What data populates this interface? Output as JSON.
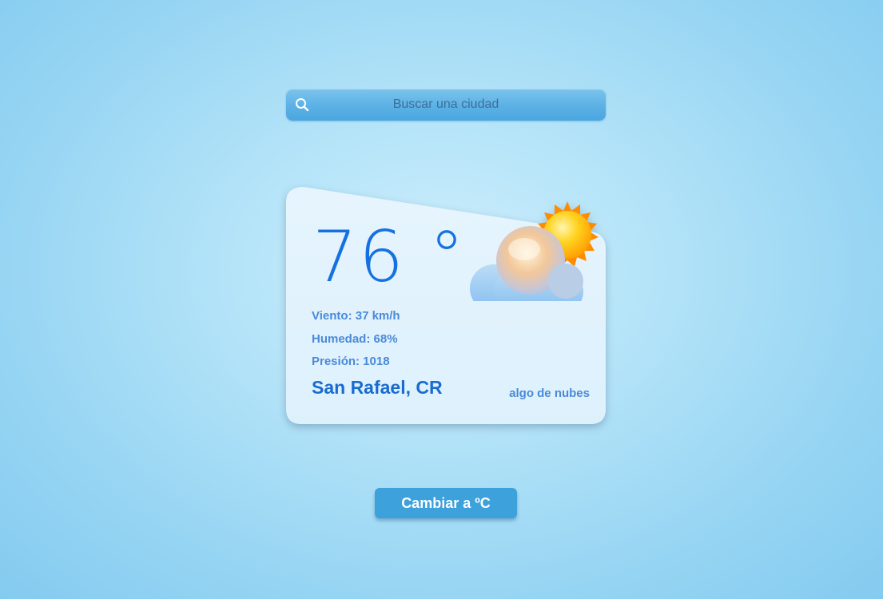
{
  "search": {
    "placeholder": "Buscar una ciudad",
    "icon": "search-icon"
  },
  "weather": {
    "temperature": "76 °",
    "icon": "partly-cloudy-icon",
    "wind": "Viento: 37 km/h",
    "humidity": "Humedad: 68%",
    "pressure": "Presión: 1018",
    "city": "San Rafael, CR",
    "description": "algo de nubes"
  },
  "toggle": {
    "label": "Cambiar a ºC"
  },
  "colors": {
    "background": "#b3e3f8",
    "accent": "#1671e0",
    "button": "#3da1dc",
    "card": "#e9f6fe"
  }
}
